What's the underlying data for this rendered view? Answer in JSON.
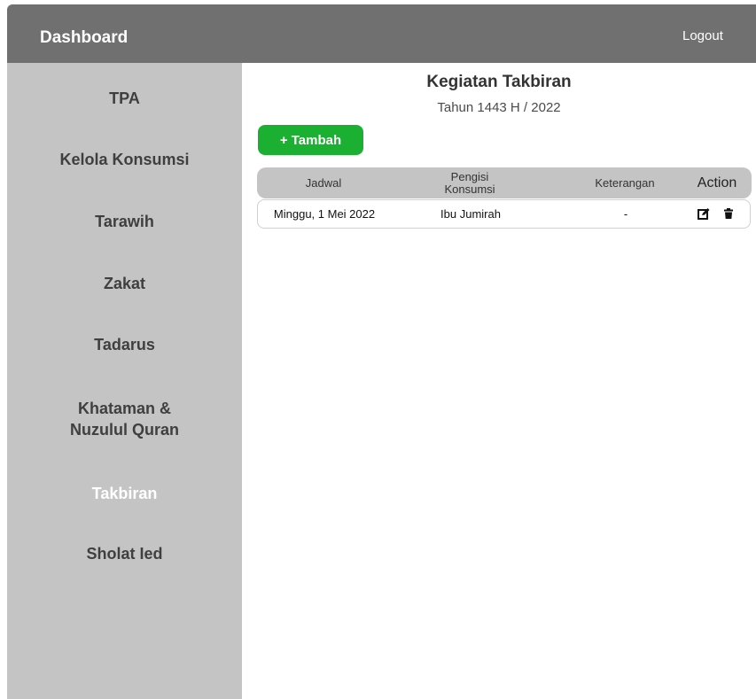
{
  "header": {
    "brand": "Dashboard",
    "logout": "Logout"
  },
  "sidebar": {
    "items": [
      {
        "label": "TPA"
      },
      {
        "label": "Kelola Konsumsi"
      },
      {
        "label": "Tarawih"
      },
      {
        "label": "Zakat"
      },
      {
        "label": "Tadarus"
      },
      {
        "label": "Khataman & Nuzulul Quran"
      },
      {
        "label": "Takbiran",
        "active": true
      },
      {
        "label": "Sholat Ied"
      }
    ]
  },
  "main": {
    "title": "Kegiatan Takbiran",
    "subtitle": "Tahun 1443 H / 2022",
    "add_label": "+ Tambah"
  },
  "table": {
    "headers": {
      "jadwal": "Jadwal",
      "pengisi_1": "Pengisi",
      "pengisi_2": "Konsumsi",
      "keterangan": "Keterangan",
      "action": "Action"
    },
    "rows": [
      {
        "jadwal": "Minggu, 1 Mei 2022",
        "pengisi": "Ibu Jumirah",
        "keterangan": "-"
      }
    ]
  },
  "colors": {
    "topbar": "#707070",
    "sidebar": "#c4c4c4",
    "accent_green": "#1cb033",
    "active_text": "#ffffff"
  }
}
